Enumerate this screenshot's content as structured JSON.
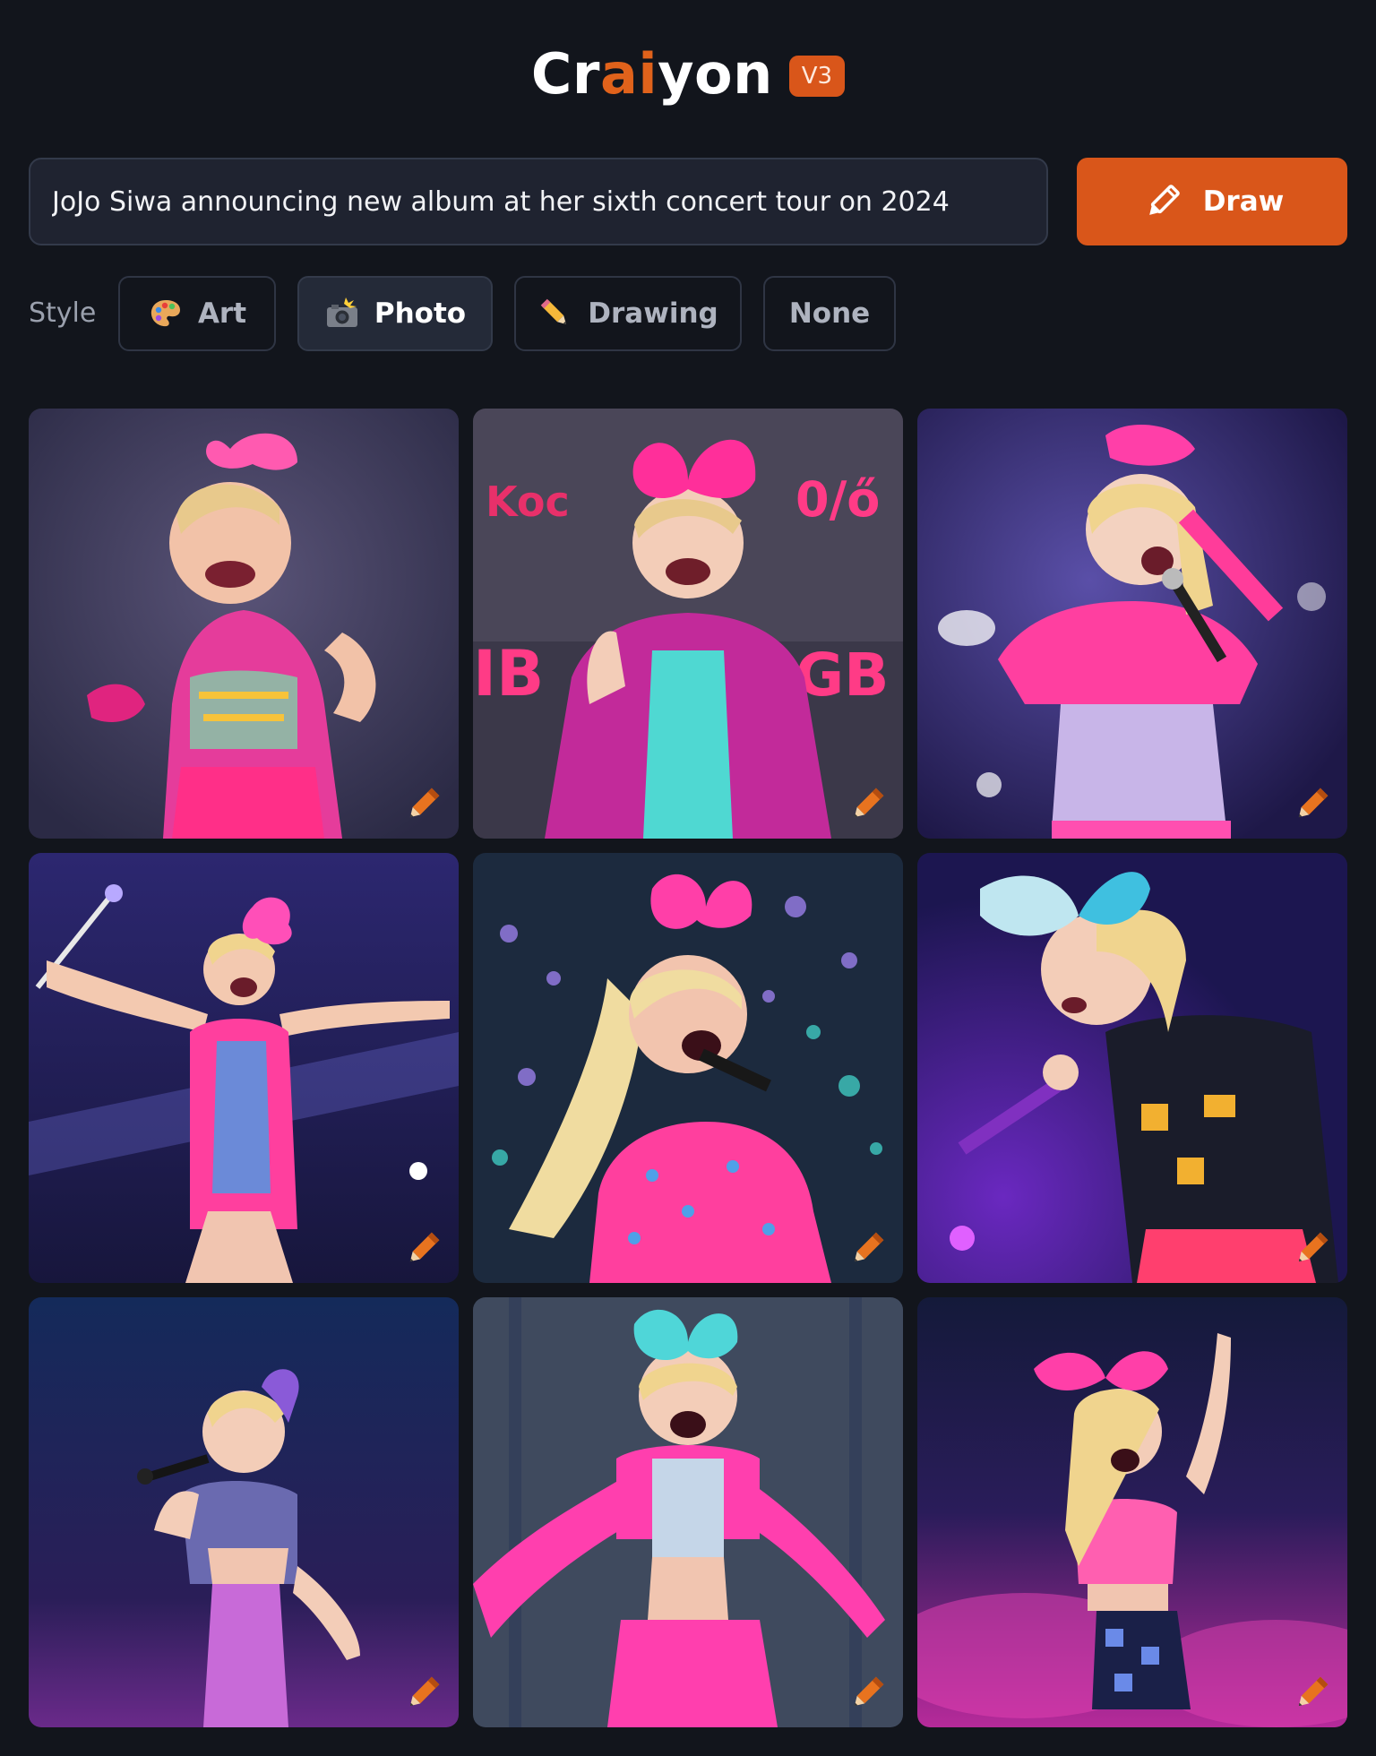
{
  "header": {
    "logo_prefix": "Cr",
    "logo_accent": "ai",
    "logo_suffix": "yon",
    "version_badge": "V3"
  },
  "prompt": {
    "value": "JoJo Siwa announcing new album at her sixth concert tour on 2024",
    "button_label": "Draw"
  },
  "style": {
    "label": "Style",
    "options": [
      {
        "label": "Art",
        "icon": "palette-icon",
        "active": false
      },
      {
        "label": "Photo",
        "icon": "camera-flash-icon",
        "active": true
      },
      {
        "label": "Drawing",
        "icon": "pencil-icon",
        "active": false
      },
      {
        "label": "None",
        "icon": "",
        "active": false
      }
    ]
  },
  "results": {
    "images": [
      {
        "name": "result-image-1"
      },
      {
        "name": "result-image-2"
      },
      {
        "name": "result-image-3"
      },
      {
        "name": "result-image-4"
      },
      {
        "name": "result-image-5"
      },
      {
        "name": "result-image-6"
      },
      {
        "name": "result-image-7"
      },
      {
        "name": "result-image-8"
      },
      {
        "name": "result-image-9"
      }
    ]
  },
  "colors": {
    "background": "#12151c",
    "accent": "#d9561a",
    "input_bg": "#1f2330"
  }
}
